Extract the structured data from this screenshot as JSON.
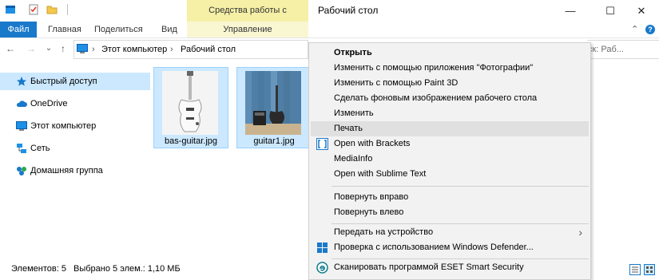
{
  "window": {
    "title": "Рабочий стол",
    "contextual_tab_group": "Средства работы с рисунками",
    "minimize_glyph": "—",
    "maximize_glyph": "☐",
    "close_glyph": "✕"
  },
  "ribbon": {
    "tabs": [
      "Файл",
      "Главная",
      "Поделиться",
      "Вид"
    ],
    "contextual_tab": "Управление",
    "collapse_glyph": "⌃",
    "help_glyph": "?"
  },
  "navigation": {
    "back_glyph": "←",
    "forward_glyph": "→",
    "dropdown_glyph": "⌄",
    "up_glyph": "↑",
    "breadcrumb": [
      "Этот компьютер",
      "Рабочий стол"
    ],
    "breadcrumb_separator": "›",
    "search_placeholder": "ск: Раб..."
  },
  "sidebar": {
    "items": [
      {
        "label": "Быстрый доступ",
        "icon": "star-icon"
      },
      {
        "label": "OneDrive",
        "icon": "cloud-icon"
      },
      {
        "label": "Этот компьютер",
        "icon": "computer-icon"
      },
      {
        "label": "Сеть",
        "icon": "network-icon"
      },
      {
        "label": "Домашняя группа",
        "icon": "homegroup-icon"
      }
    ]
  },
  "files": [
    {
      "name": "bas-guitar.jpg"
    },
    {
      "name": "guitar1.jpg"
    }
  ],
  "status": {
    "count": "Элементов: 5",
    "selection": "Выбрано 5 элем.: 1,10 МБ"
  },
  "context_menu": {
    "items": [
      {
        "label": "Открыть",
        "bold": true
      },
      {
        "label": "Изменить с помощью приложения \"Фотографии\""
      },
      {
        "label": "Изменить с помощью Paint 3D"
      },
      {
        "label": "Сделать фоновым изображением рабочего стола"
      },
      {
        "label": "Изменить"
      },
      {
        "label": "Печать"
      },
      {
        "label": "Open with Brackets",
        "icon": "brackets-icon"
      },
      {
        "label": "MediaInfo"
      },
      {
        "label": "Open with Sublime Text"
      },
      {
        "label": "Повернуть вправо"
      },
      {
        "label": "Повернуть влево"
      },
      {
        "label": "Передать на устройство",
        "submenu": true
      },
      {
        "label": "Проверка с использованием Windows Defender...",
        "icon": "windows-defender-icon"
      },
      {
        "label": "Сканировать программой ESET Smart Security",
        "icon": "eset-icon"
      }
    ],
    "submenu_glyph": "›"
  },
  "colors": {
    "accent": "#1979ca",
    "selection": "#cce8ff",
    "contextual_tab": "#f5f0a6",
    "menu_bg": "#f2f2f2",
    "menu_hover": "#e0e0e0"
  }
}
